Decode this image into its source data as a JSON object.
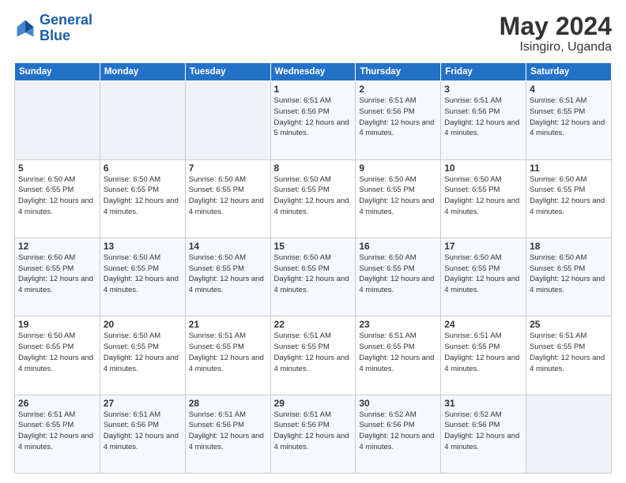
{
  "header": {
    "logo_line1": "General",
    "logo_line2": "Blue",
    "month": "May 2024",
    "location": "Isingiro, Uganda"
  },
  "weekdays": [
    "Sunday",
    "Monday",
    "Tuesday",
    "Wednesday",
    "Thursday",
    "Friday",
    "Saturday"
  ],
  "weeks": [
    [
      {
        "day": "",
        "sunrise": "",
        "sunset": "",
        "daylight": "",
        "empty": true
      },
      {
        "day": "",
        "sunrise": "",
        "sunset": "",
        "daylight": "",
        "empty": true
      },
      {
        "day": "",
        "sunrise": "",
        "sunset": "",
        "daylight": "",
        "empty": true
      },
      {
        "day": "1",
        "sunrise": "Sunrise: 6:51 AM",
        "sunset": "Sunset: 6:56 PM",
        "daylight": "Daylight: 12 hours and 5 minutes."
      },
      {
        "day": "2",
        "sunrise": "Sunrise: 6:51 AM",
        "sunset": "Sunset: 6:56 PM",
        "daylight": "Daylight: 12 hours and 4 minutes."
      },
      {
        "day": "3",
        "sunrise": "Sunrise: 6:51 AM",
        "sunset": "Sunset: 6:56 PM",
        "daylight": "Daylight: 12 hours and 4 minutes."
      },
      {
        "day": "4",
        "sunrise": "Sunrise: 6:51 AM",
        "sunset": "Sunset: 6:55 PM",
        "daylight": "Daylight: 12 hours and 4 minutes."
      }
    ],
    [
      {
        "day": "5",
        "sunrise": "Sunrise: 6:50 AM",
        "sunset": "Sunset: 6:55 PM",
        "daylight": "Daylight: 12 hours and 4 minutes."
      },
      {
        "day": "6",
        "sunrise": "Sunrise: 6:50 AM",
        "sunset": "Sunset: 6:55 PM",
        "daylight": "Daylight: 12 hours and 4 minutes."
      },
      {
        "day": "7",
        "sunrise": "Sunrise: 6:50 AM",
        "sunset": "Sunset: 6:55 PM",
        "daylight": "Daylight: 12 hours and 4 minutes."
      },
      {
        "day": "8",
        "sunrise": "Sunrise: 6:50 AM",
        "sunset": "Sunset: 6:55 PM",
        "daylight": "Daylight: 12 hours and 4 minutes."
      },
      {
        "day": "9",
        "sunrise": "Sunrise: 6:50 AM",
        "sunset": "Sunset: 6:55 PM",
        "daylight": "Daylight: 12 hours and 4 minutes."
      },
      {
        "day": "10",
        "sunrise": "Sunrise: 6:50 AM",
        "sunset": "Sunset: 6:55 PM",
        "daylight": "Daylight: 12 hours and 4 minutes."
      },
      {
        "day": "11",
        "sunrise": "Sunrise: 6:50 AM",
        "sunset": "Sunset: 6:55 PM",
        "daylight": "Daylight: 12 hours and 4 minutes."
      }
    ],
    [
      {
        "day": "12",
        "sunrise": "Sunrise: 6:50 AM",
        "sunset": "Sunset: 6:55 PM",
        "daylight": "Daylight: 12 hours and 4 minutes."
      },
      {
        "day": "13",
        "sunrise": "Sunrise: 6:50 AM",
        "sunset": "Sunset: 6:55 PM",
        "daylight": "Daylight: 12 hours and 4 minutes."
      },
      {
        "day": "14",
        "sunrise": "Sunrise: 6:50 AM",
        "sunset": "Sunset: 6:55 PM",
        "daylight": "Daylight: 12 hours and 4 minutes."
      },
      {
        "day": "15",
        "sunrise": "Sunrise: 6:50 AM",
        "sunset": "Sunset: 6:55 PM",
        "daylight": "Daylight: 12 hours and 4 minutes."
      },
      {
        "day": "16",
        "sunrise": "Sunrise: 6:50 AM",
        "sunset": "Sunset: 6:55 PM",
        "daylight": "Daylight: 12 hours and 4 minutes."
      },
      {
        "day": "17",
        "sunrise": "Sunrise: 6:50 AM",
        "sunset": "Sunset: 6:55 PM",
        "daylight": "Daylight: 12 hours and 4 minutes."
      },
      {
        "day": "18",
        "sunrise": "Sunrise: 6:50 AM",
        "sunset": "Sunset: 6:55 PM",
        "daylight": "Daylight: 12 hours and 4 minutes."
      }
    ],
    [
      {
        "day": "19",
        "sunrise": "Sunrise: 6:50 AM",
        "sunset": "Sunset: 6:55 PM",
        "daylight": "Daylight: 12 hours and 4 minutes."
      },
      {
        "day": "20",
        "sunrise": "Sunrise: 6:50 AM",
        "sunset": "Sunset: 6:55 PM",
        "daylight": "Daylight: 12 hours and 4 minutes."
      },
      {
        "day": "21",
        "sunrise": "Sunrise: 6:51 AM",
        "sunset": "Sunset: 6:55 PM",
        "daylight": "Daylight: 12 hours and 4 minutes."
      },
      {
        "day": "22",
        "sunrise": "Sunrise: 6:51 AM",
        "sunset": "Sunset: 6:55 PM",
        "daylight": "Daylight: 12 hours and 4 minutes."
      },
      {
        "day": "23",
        "sunrise": "Sunrise: 6:51 AM",
        "sunset": "Sunset: 6:55 PM",
        "daylight": "Daylight: 12 hours and 4 minutes."
      },
      {
        "day": "24",
        "sunrise": "Sunrise: 6:51 AM",
        "sunset": "Sunset: 6:55 PM",
        "daylight": "Daylight: 12 hours and 4 minutes."
      },
      {
        "day": "25",
        "sunrise": "Sunrise: 6:51 AM",
        "sunset": "Sunset: 6:55 PM",
        "daylight": "Daylight: 12 hours and 4 minutes."
      }
    ],
    [
      {
        "day": "26",
        "sunrise": "Sunrise: 6:51 AM",
        "sunset": "Sunset: 6:55 PM",
        "daylight": "Daylight: 12 hours and 4 minutes."
      },
      {
        "day": "27",
        "sunrise": "Sunrise: 6:51 AM",
        "sunset": "Sunset: 6:56 PM",
        "daylight": "Daylight: 12 hours and 4 minutes."
      },
      {
        "day": "28",
        "sunrise": "Sunrise: 6:51 AM",
        "sunset": "Sunset: 6:56 PM",
        "daylight": "Daylight: 12 hours and 4 minutes."
      },
      {
        "day": "29",
        "sunrise": "Sunrise: 6:51 AM",
        "sunset": "Sunset: 6:56 PM",
        "daylight": "Daylight: 12 hours and 4 minutes."
      },
      {
        "day": "30",
        "sunrise": "Sunrise: 6:52 AM",
        "sunset": "Sunset: 6:56 PM",
        "daylight": "Daylight: 12 hours and 4 minutes."
      },
      {
        "day": "31",
        "sunrise": "Sunrise: 6:52 AM",
        "sunset": "Sunset: 6:56 PM",
        "daylight": "Daylight: 12 hours and 4 minutes."
      },
      {
        "day": "",
        "sunrise": "",
        "sunset": "",
        "daylight": "",
        "empty": true
      }
    ]
  ]
}
